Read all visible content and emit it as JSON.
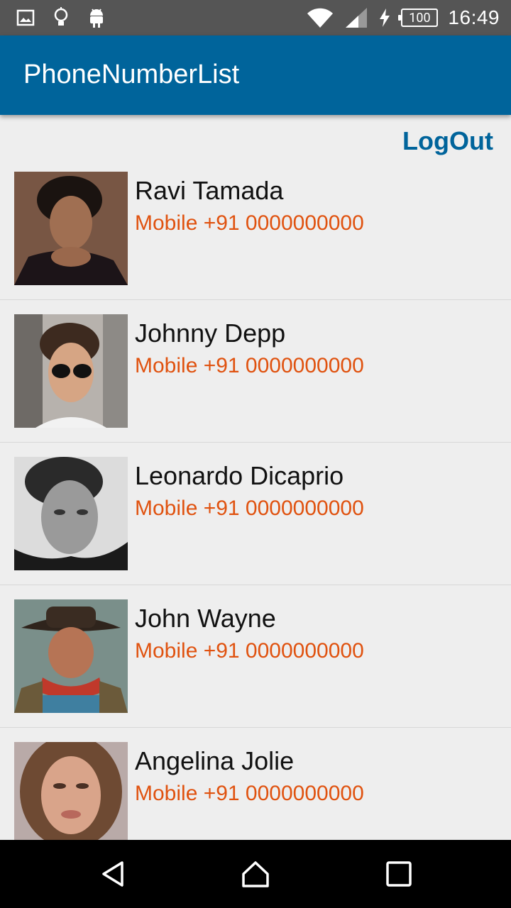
{
  "status_bar": {
    "time": "16:49",
    "battery": "100",
    "icons_left": [
      "image-icon",
      "lightbulb-icon",
      "android-icon"
    ],
    "icons_right": [
      "wifi-icon",
      "signal-icon",
      "charging-icon",
      "battery-icon"
    ]
  },
  "app_bar": {
    "title": "PhoneNumberList",
    "color": "#00649b"
  },
  "logout_label": "LogOut",
  "contacts": [
    {
      "name": "Ravi Tamada",
      "phone": "Mobile +91 0000000000"
    },
    {
      "name": "Johnny Depp",
      "phone": "Mobile +91 0000000000"
    },
    {
      "name": "Leonardo Dicaprio",
      "phone": "Mobile +91 0000000000"
    },
    {
      "name": "John Wayne",
      "phone": "Mobile +91 0000000000"
    },
    {
      "name": "Angelina Jolie",
      "phone": "Mobile +91 0000000000"
    }
  ],
  "colors": {
    "phone_text": "#e0520f",
    "background": "#eeeeee"
  },
  "nav_bar": [
    "back-icon",
    "home-icon",
    "recents-icon"
  ]
}
